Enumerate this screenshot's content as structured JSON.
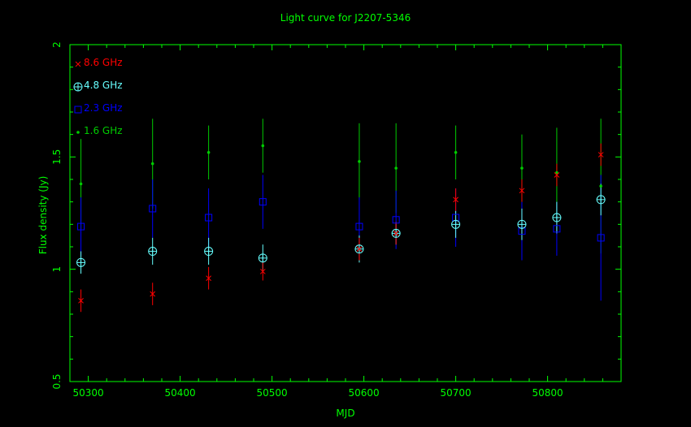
{
  "chart_data": {
    "type": "scatter",
    "title": "Light curve for J2207-5346",
    "xlabel": "MJD",
    "ylabel": "Flux density (Jy)",
    "xlim": [
      50280,
      50880
    ],
    "ylim": [
      0.5,
      2.0
    ],
    "xticks": [
      50300,
      50400,
      50500,
      50600,
      50700,
      50800
    ],
    "xtick_labels": [
      "50300",
      "50400",
      "50500",
      "50600",
      "50700",
      "50800"
    ],
    "yticks": [
      0.5,
      1,
      1.5,
      2
    ],
    "ytick_labels": [
      "0.5",
      "1",
      "1.5",
      "2"
    ],
    "legend_position": "top-left",
    "axis_color": "#00ff00",
    "series": [
      {
        "name": "8.6 GHz",
        "marker": "x",
        "color": "#ff0000",
        "points": [
          {
            "x": 50292,
            "y": 0.86,
            "err": 0.05
          },
          {
            "x": 50370,
            "y": 0.89,
            "err": 0.05
          },
          {
            "x": 50431,
            "y": 0.96,
            "err": 0.05
          },
          {
            "x": 50490,
            "y": 0.99,
            "err": 0.04
          },
          {
            "x": 50595,
            "y": 1.09,
            "err": 0.05
          },
          {
            "x": 50635,
            "y": 1.16,
            "err": 0.05
          },
          {
            "x": 50700,
            "y": 1.31,
            "err": 0.05
          },
          {
            "x": 50772,
            "y": 1.35,
            "err": 0.05
          },
          {
            "x": 50810,
            "y": 1.42,
            "err": 0.05
          },
          {
            "x": 50858,
            "y": 1.51,
            "err": 0.05
          }
        ]
      },
      {
        "name": "4.8 GHz",
        "marker": "circle-plus",
        "color": "#66ffff",
        "points": [
          {
            "x": 50292,
            "y": 1.03,
            "err": 0.05
          },
          {
            "x": 50370,
            "y": 1.08,
            "err": 0.06
          },
          {
            "x": 50431,
            "y": 1.08,
            "err": 0.06
          },
          {
            "x": 50490,
            "y": 1.05,
            "err": 0.06
          },
          {
            "x": 50595,
            "y": 1.09,
            "err": 0.06
          },
          {
            "x": 50635,
            "y": 1.16,
            "err": 0.05
          },
          {
            "x": 50700,
            "y": 1.2,
            "err": 0.06
          },
          {
            "x": 50772,
            "y": 1.2,
            "err": 0.07
          },
          {
            "x": 50810,
            "y": 1.23,
            "err": 0.07
          },
          {
            "x": 50858,
            "y": 1.31,
            "err": 0.07
          }
        ]
      },
      {
        "name": "2.3 GHz",
        "marker": "square",
        "color": "#0000ff",
        "points": [
          {
            "x": 50292,
            "y": 1.19,
            "err": 0.13
          },
          {
            "x": 50370,
            "y": 1.27,
            "err": 0.13
          },
          {
            "x": 50431,
            "y": 1.23,
            "err": 0.13
          },
          {
            "x": 50490,
            "y": 1.3,
            "err": 0.12
          },
          {
            "x": 50595,
            "y": 1.19,
            "err": 0.13
          },
          {
            "x": 50635,
            "y": 1.22,
            "err": 0.13
          },
          {
            "x": 50700,
            "y": 1.23,
            "err": 0.13
          },
          {
            "x": 50772,
            "y": 1.17,
            "err": 0.13
          },
          {
            "x": 50810,
            "y": 1.18,
            "err": 0.12
          },
          {
            "x": 50858,
            "y": 1.14,
            "err": 0.28
          }
        ]
      },
      {
        "name": "1.6 GHz",
        "marker": "dot",
        "color": "#00cc00",
        "points": [
          {
            "x": 50292,
            "y": 1.38,
            "err": 0.2
          },
          {
            "x": 50370,
            "y": 1.47,
            "err": 0.2
          },
          {
            "x": 50431,
            "y": 1.52,
            "err": 0.12
          },
          {
            "x": 50490,
            "y": 1.55,
            "err": 0.12
          },
          {
            "x": 50595,
            "y": 1.48,
            "err": 0.17
          },
          {
            "x": 50635,
            "y": 1.45,
            "err": 0.2
          },
          {
            "x": 50700,
            "y": 1.52,
            "err": 0.12
          },
          {
            "x": 50772,
            "y": 1.45,
            "err": 0.15
          },
          {
            "x": 50810,
            "y": 1.43,
            "err": 0.2
          },
          {
            "x": 50858,
            "y": 1.37,
            "err": 0.3
          }
        ]
      }
    ]
  }
}
